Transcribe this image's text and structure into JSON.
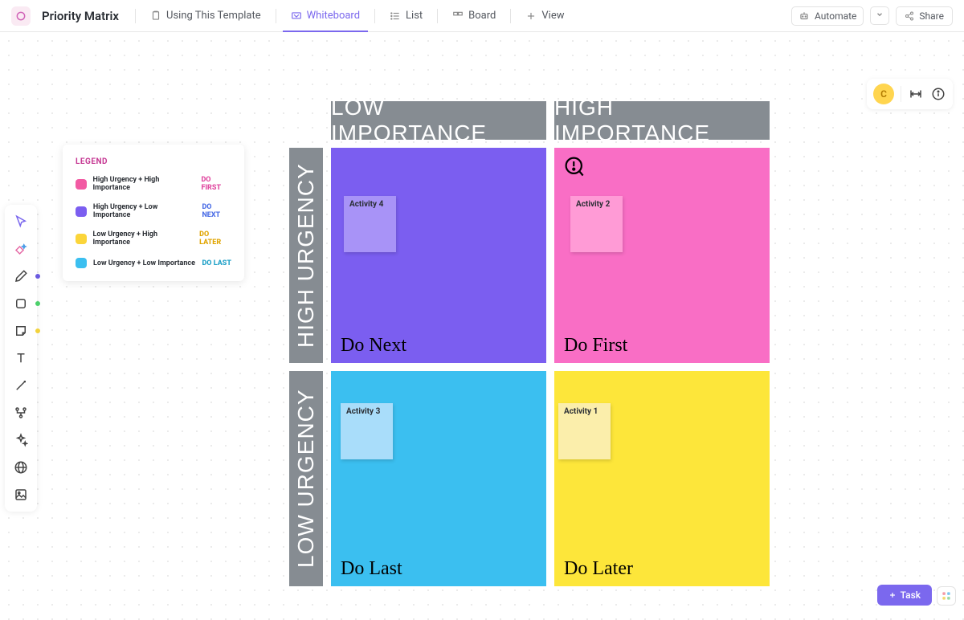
{
  "header": {
    "title": "Priority Matrix",
    "views": [
      {
        "label": "Using This Template",
        "icon": "template-icon"
      },
      {
        "label": "Whiteboard",
        "icon": "whiteboard-icon"
      },
      {
        "label": "List",
        "icon": "list-icon"
      },
      {
        "label": "Board",
        "icon": "board-icon"
      },
      {
        "label": "View",
        "icon": "plus-icon"
      }
    ],
    "automate_label": "Automate",
    "share_label": "Share"
  },
  "right_panel": {
    "avatar_initial": "C"
  },
  "legend": {
    "title": "LEGEND",
    "rows": [
      {
        "color": "#f25aa3",
        "text": "High Urgency + High Importance",
        "tag": "DO FIRST",
        "tag_color": "#e048a0"
      },
      {
        "color": "#7b5ef0",
        "text": "High Urgency + Low Importance",
        "tag": "DO NEXT",
        "tag_color": "#4c6ee6"
      },
      {
        "color": "#fbd53a",
        "text": "Low Urgency + High Importance",
        "tag": "DO LATER",
        "tag_color": "#e0a400"
      },
      {
        "color": "#3bbff0",
        "text": "Low Urgency + Low Importance",
        "tag": "DO LAST",
        "tag_color": "#1fa0c7"
      }
    ]
  },
  "matrix": {
    "columns": [
      "LOW IMPORTANCE",
      "HIGH IMPORTANCE"
    ],
    "rows": [
      "HIGH URGENCY",
      "LOW URGENCY"
    ],
    "quadrants": {
      "doNext": {
        "label": "Do Next",
        "card": "Activity 4"
      },
      "doFirst": {
        "label": "Do First",
        "card": "Activity 2"
      },
      "doLast": {
        "label": "Do Last",
        "card": "Activity 3"
      },
      "doLater": {
        "label": "Do Later",
        "card": "Activity 1"
      }
    }
  },
  "footer": {
    "task_label": "Task"
  }
}
